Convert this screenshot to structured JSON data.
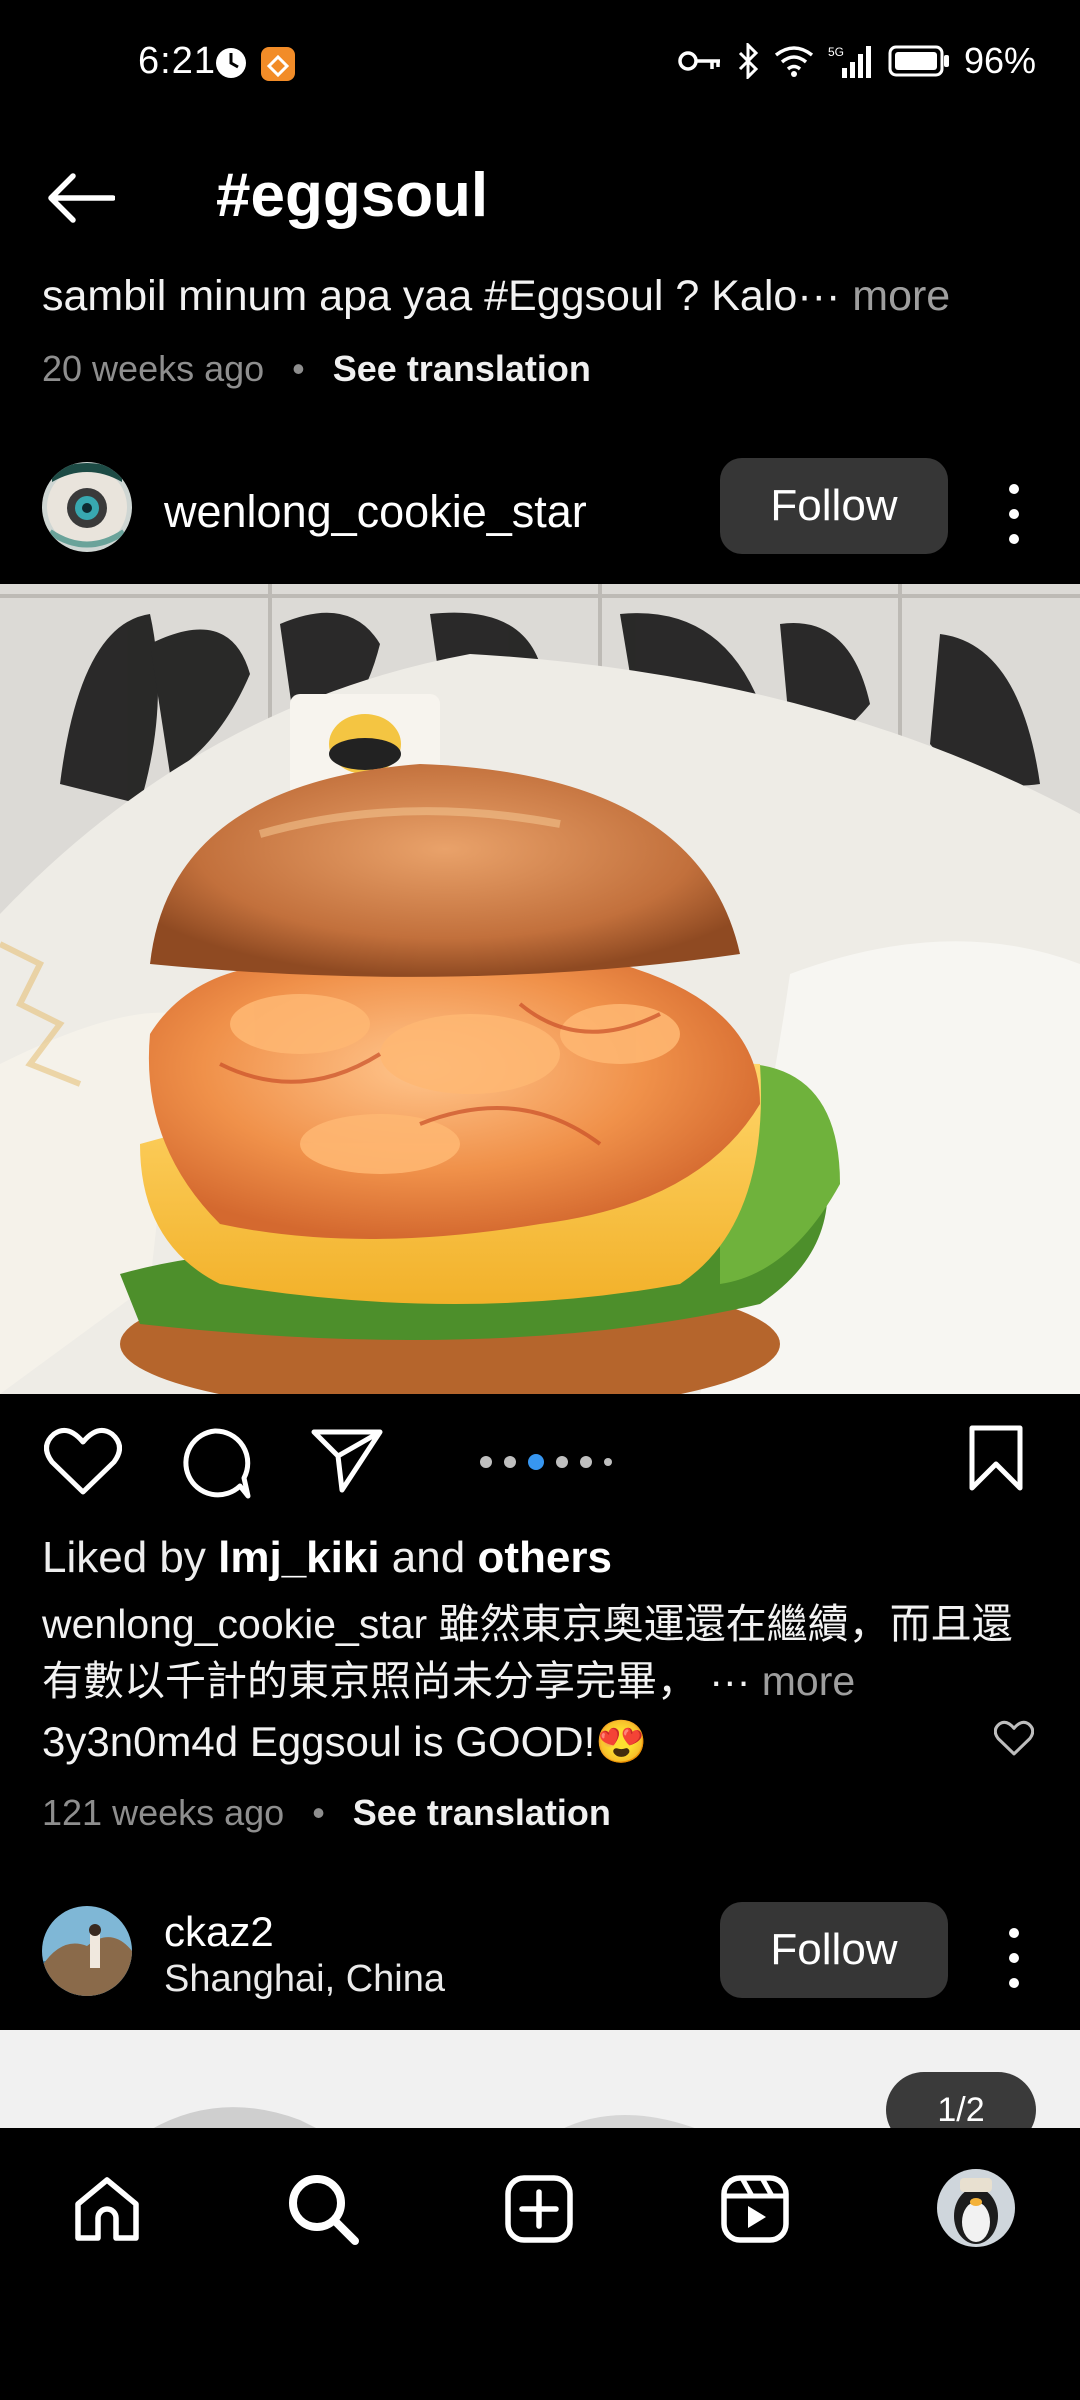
{
  "status_bar": {
    "time": "6:21",
    "battery": "96%",
    "network": "5G"
  },
  "header": {
    "title": "#eggsoul"
  },
  "prev_post": {
    "caption": "sambil minum apa yaa #Eggsoul ? Kalo",
    "ellipsis": "···",
    "more": "more",
    "time_ago": "20 weeks ago",
    "dot": "•",
    "see_translation": "See translation"
  },
  "post": {
    "username": "wenlong_cookie_star",
    "follow_label": "Follow",
    "liked_prefix": "Liked by",
    "liked_user": "lmj_kiki",
    "liked_and": "and",
    "liked_others": "others",
    "caption_user": "wenlong_cookie_star",
    "caption_text": "雖然東京奧運還在繼續，而且還有數以千計的東京照尚未分享完畢，",
    "caption_ellipsis": "···",
    "caption_more": "more",
    "comment_user": "3y3n0m4d",
    "comment_text": "Eggsoul is GOOD!😍",
    "time_ago": "121 weeks ago",
    "dot": "•",
    "see_translation": "See translation",
    "carousel_active_index": 2,
    "carousel_count": 6
  },
  "next_post": {
    "username": "ckaz2",
    "location": "Shanghai, China",
    "follow_label": "Follow",
    "counter": "1/2"
  },
  "icons": {
    "back": "arrow-left-icon",
    "like": "heart-icon",
    "comment": "comment-icon",
    "share": "send-icon",
    "save": "bookmark-icon",
    "home": "home-icon",
    "search": "search-icon",
    "create": "plus-square-icon",
    "reels": "reels-icon",
    "profile": "profile-avatar"
  },
  "colors": {
    "background": "#000000",
    "follow_button": "#363636",
    "carousel_active": "#3796f0",
    "secondary_text": "#8e8e8e"
  }
}
